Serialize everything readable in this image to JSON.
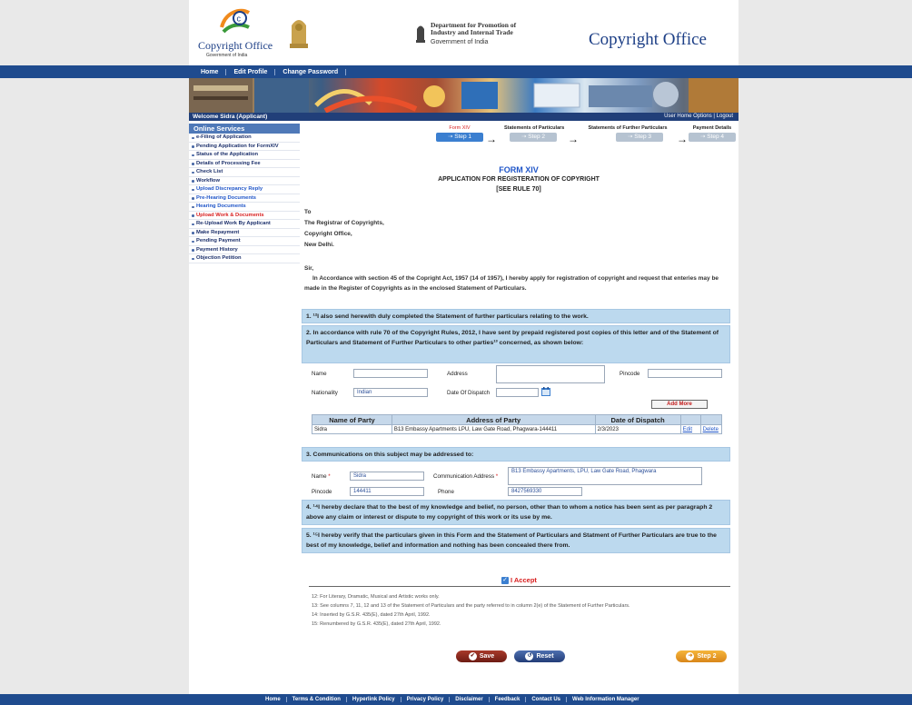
{
  "header": {
    "logo_title": "Copyright Office",
    "logo_subtitle": "Government of India",
    "dept_line1": "Department for Promotion of",
    "dept_line2": "Industry and Internal Trade",
    "dept_line3": "Government of India",
    "site_title": "Copyright Office"
  },
  "nav": {
    "items": [
      "Home",
      "Edit Profile",
      "Change Password"
    ]
  },
  "welcome": {
    "text": "Welcome Sidra (Applicant)",
    "right": "User Home  Options  |  Logout"
  },
  "sidebar": {
    "heading": "Online Services",
    "items": [
      {
        "label": "e-Filing of Application",
        "style": "dark"
      },
      {
        "label": "Pending Application for FormXIV",
        "style": "dark"
      },
      {
        "label": "Status of the Application",
        "style": "dark"
      },
      {
        "label": "Details of Processing Fee",
        "style": "dark"
      },
      {
        "label": "Check List",
        "style": "dark"
      },
      {
        "label": "Workflow",
        "style": "dark"
      },
      {
        "label": "Upload Discrepancy Reply",
        "style": "blue"
      },
      {
        "label": "Pre-Hearing Documents",
        "style": "blue"
      },
      {
        "label": "Hearing Documents",
        "style": "blue"
      },
      {
        "label": "Upload Work & Documents",
        "style": "red"
      },
      {
        "label": "Re-Upload Work By Applicant",
        "style": "dark"
      },
      {
        "label": "Make Repayment",
        "style": "dark"
      },
      {
        "label": "Pending Payment",
        "style": "dark"
      },
      {
        "label": "Payment History",
        "style": "dark"
      },
      {
        "label": "Objection Petition",
        "style": "dark"
      }
    ]
  },
  "steps": [
    {
      "label": "Form XIV",
      "button": "Step 1"
    },
    {
      "label": "Statements of Particulars",
      "button": "Step 2"
    },
    {
      "label": "Statements of Further Particulars",
      "button": "Step 3"
    },
    {
      "label": "Payment Details",
      "button": "Step 4"
    }
  ],
  "form": {
    "title": "FORM XIV",
    "subtitle": "APPLICATION FOR REGISTERATION OF COPYRIGHT",
    "rule": "[SEE RULE 70]",
    "to_lines": [
      "To",
      "The Registrar of Copyrights,",
      "Copyright Office,",
      "New Delhi."
    ],
    "salutation": "Sir,",
    "intro": "In Accordance with section 45 of the Copright Act, 1957 (14 of 1957), I hereby apply for registration of copyright and request that enteries may be made in the Register of Copyrights as in the enclosed Statement of Particulars.",
    "item1": "1. ¹²I also send herewith duly completed the Statement of further particulars relating to the work.",
    "item2": "2. In accordance with rule 70 of the Copyright Rules, 2012, I have sent by prepaid registered post copies of this letter and of the Statement of Particulars and Statement of Further Particulars to other parties¹³ concerned, as shown below:",
    "name_label": "Name",
    "address_label": "Address",
    "pincode_label": "Pincode",
    "nationality_label": "Nationality",
    "nationality_value": "Indian",
    "dispatch_label": "Date Of Dispatch",
    "add_more": "Add More",
    "table": {
      "headers": [
        "Name of Party",
        "Address of Party",
        "Date of Dispatch"
      ],
      "rows": [
        {
          "name": "Sidra",
          "address": "B13 Embassy Apartments LPU, Law Gate Road, Phagwara-144411",
          "date": "2/3/2023",
          "edit": "Edit",
          "delete": "Delete"
        }
      ]
    },
    "item3": "3. Communications on this subject may be addressed to:",
    "comm_name_label": "Name",
    "comm_name_value": "Sidra",
    "comm_address_label": "Communication Address",
    "comm_address_value": "B13 Embassy Apartments, LPU, Law Gate Road, Phagwara",
    "comm_pincode_label": "Pincode",
    "comm_pincode_value": "144411",
    "comm_phone_label": "Phone",
    "comm_phone_value": "8427569330",
    "item4": "4. ¹⁴I hereby declare that to the best of my knowledge and belief, no person, other than to whom a notice has been sent as per paragraph 2 above any claim or interest or dispute to my copyright of this work or its use by me.",
    "item5": "5. ¹⁵I hereby verify that the particulars given in this Form and the Statement of Particulars and Statment of Further Particulars are true to the best of my knowledge, belief and information and nothing has been concealed there from.",
    "accept_label": "I Accept",
    "footnotes": [
      "12: For Literary, Dramatic, Musical and Artistic works only.",
      "13: See columns 7, 11, 12 and 13 of the Statement of Particulars and the party referred to in column 2(e) of the Statement of Further Particulars.",
      "14: Inserted by G.S.R. 435(E), dated 27th April, 1992.",
      "15: Renumbered by G.S.R. 435(E), dated 27th April, 1992."
    ],
    "save": "Save",
    "reset": "Reset",
    "next": "Step 2"
  },
  "footer": {
    "links": [
      "Home",
      "Terms & Condition",
      "Hyperlink Policy",
      "Privacy Policy",
      "Disclaimer",
      "Feedback",
      "Contact Us",
      "Web Information Manager"
    ]
  },
  "colors": {
    "nav": "#1f4b8e",
    "sidebar_head": "#4f79b8",
    "blue_box": "#bcd9ee",
    "accent_red": "#d81f1f"
  }
}
